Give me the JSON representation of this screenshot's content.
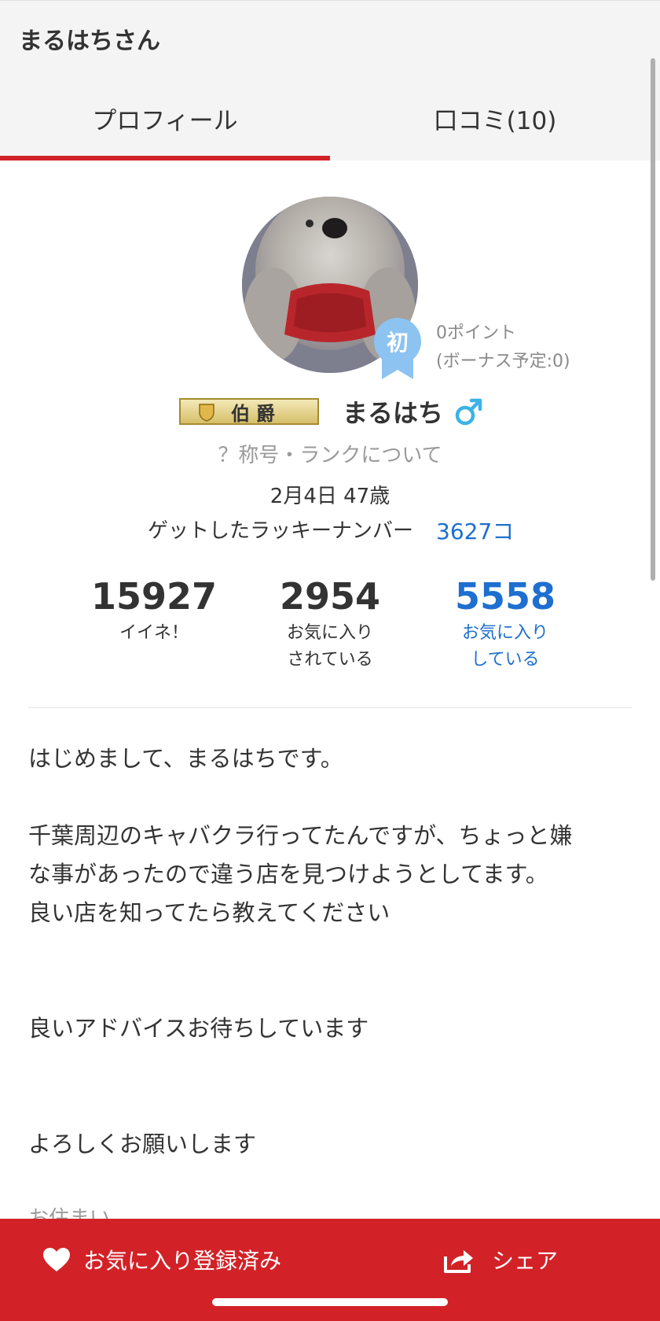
{
  "header": {
    "title": "まるはちさん"
  },
  "tabs": [
    {
      "label": "プロフィール",
      "active": true
    },
    {
      "label": "口コミ(10)",
      "active": false
    }
  ],
  "profile": {
    "rank_badge_char": "初",
    "points": "0ポイント",
    "bonus": "(ボーナス予定:0)",
    "title_badge": "伯爵",
    "username": "まるはち",
    "gender_icon": "male-icon",
    "rank_link": "？称号・ランクについて",
    "birthday_age": "2月4日 47歳",
    "lucky_label": "ゲットしたラッキーナンバー",
    "lucky_value": "3627コ"
  },
  "stats": {
    "likes": {
      "value": "15927",
      "label": "イイネ！"
    },
    "favorited_by": {
      "value": "2954",
      "label_1": "お気に入り",
      "label_2": "されている"
    },
    "favoriting": {
      "value": "5558",
      "label_1": "お気に入り",
      "label_2": "している"
    }
  },
  "bio": [
    "はじめまして、まるはちです。",
    "",
    "千葉周辺のキャバクラ行ってたんですが、ちょっと嫌",
    "な事があったので違う店を見つけようとしてます。",
    "良い店を知ってたら教えてください",
    "",
    "",
    "良いアドバイスお待ちしています",
    "",
    "",
    "よろしくお願いします"
  ],
  "residence_label": "お住まい",
  "actions": {
    "favorite_label": "お気に入り登録済み",
    "share_label": "シェア"
  },
  "colors": {
    "accent_red": "#d22227",
    "link_blue": "#1e6fd0",
    "badge_blue": "#8cc3f0"
  }
}
